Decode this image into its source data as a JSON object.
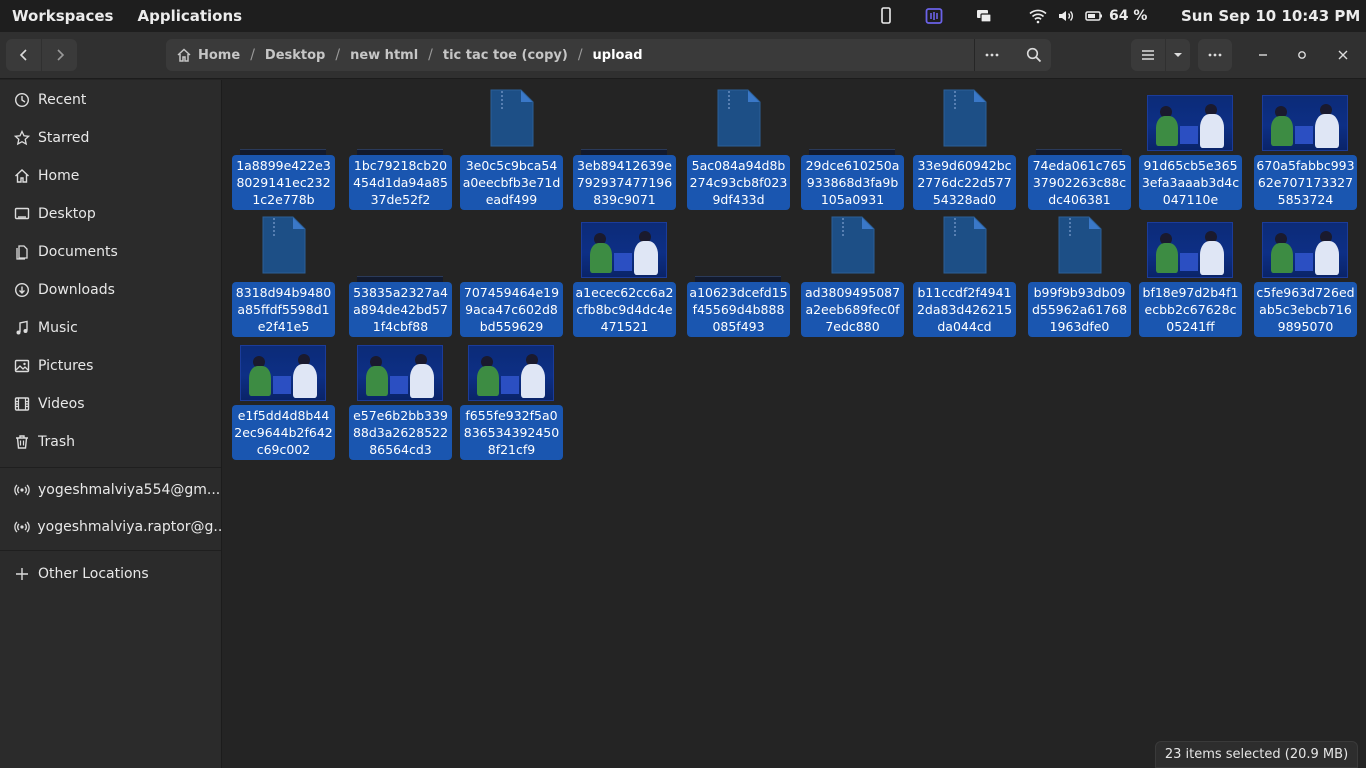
{
  "topbar": {
    "workspaces": "Workspaces",
    "applications": "Applications",
    "battery": "64 %",
    "clock": "Sun Sep 10  10:43 PM"
  },
  "path": {
    "home": "Home",
    "desktop": "Desktop",
    "new_html": "new html",
    "tic": "tic tac toe (copy)",
    "upload": "upload"
  },
  "sidebar": {
    "recent": "Recent",
    "starred": "Starred",
    "home": "Home",
    "desktop": "Desktop",
    "documents": "Documents",
    "downloads": "Downloads",
    "music": "Music",
    "pictures": "Pictures",
    "videos": "Videos",
    "trash": "Trash",
    "account1": "yogeshmalviya554@gm...",
    "account2": "yogeshmalviya.raptor@g...",
    "other": "Other Locations"
  },
  "files": [
    {
      "name": "1a8899e422e38029141ec2321c2e778b",
      "kind": "dark"
    },
    {
      "name": "1bc79218cb20454d1da94a8537de52f2",
      "kind": "dark"
    },
    {
      "name": "3e0c5c9bca54a0eecbfb3e71deadf499",
      "kind": "doc"
    },
    {
      "name": "3eb89412639e792937477196839c9071",
      "kind": "dark"
    },
    {
      "name": "5ac084a94d8b274c93cb8f0239df433d",
      "kind": "doc"
    },
    {
      "name": "29dce610250a933868d3fa9b105a0931",
      "kind": "dark"
    },
    {
      "name": "33e9d60942bc2776dc22d57754328ad0",
      "kind": "doc"
    },
    {
      "name": "74eda061c76537902263c88cdc406381",
      "kind": "dark"
    },
    {
      "name": "91d65cb5e3653efa3aaab3d4c047110e",
      "kind": "photo"
    },
    {
      "name": "670a5fabbc99362e7071733275853724",
      "kind": "photo"
    },
    {
      "name": "8318d94b9480a85ffdf5598d1e2f41e5",
      "kind": "doc"
    },
    {
      "name": "53835a2327a4a894de42bd571f4cbf88",
      "kind": "dark"
    },
    {
      "name": "707459464e199aca47c602d8bd559629",
      "kind": "none"
    },
    {
      "name": "a1ecec62cc6a2cfb8bc9d4dc4e471521",
      "kind": "photo"
    },
    {
      "name": "a10623dcefd15f45569d4b888085f493",
      "kind": "dark"
    },
    {
      "name": "ad3809495087a2eeb689fec0f7edc880",
      "kind": "doc"
    },
    {
      "name": "b11ccdf2f49412da83d426215da044cd",
      "kind": "doc"
    },
    {
      "name": "b99f9b93db09d55962a617681963dfe0",
      "kind": "doc"
    },
    {
      "name": "bf18e97d2b4f1ecbb2c67628c05241ff",
      "kind": "photo"
    },
    {
      "name": "c5fe963d726edab5c3ebcb7169895070",
      "kind": "photo"
    },
    {
      "name": "e1f5dd4d8b442ec9644b2f642c69c002",
      "kind": "photo"
    },
    {
      "name": "e57e6b2bb33988d3a262852286564cd3",
      "kind": "photo"
    },
    {
      "name": "f655fe932f5a08365343924508f21cf9",
      "kind": "photo"
    }
  ],
  "status": "23 items selected  (20.9 MB)"
}
